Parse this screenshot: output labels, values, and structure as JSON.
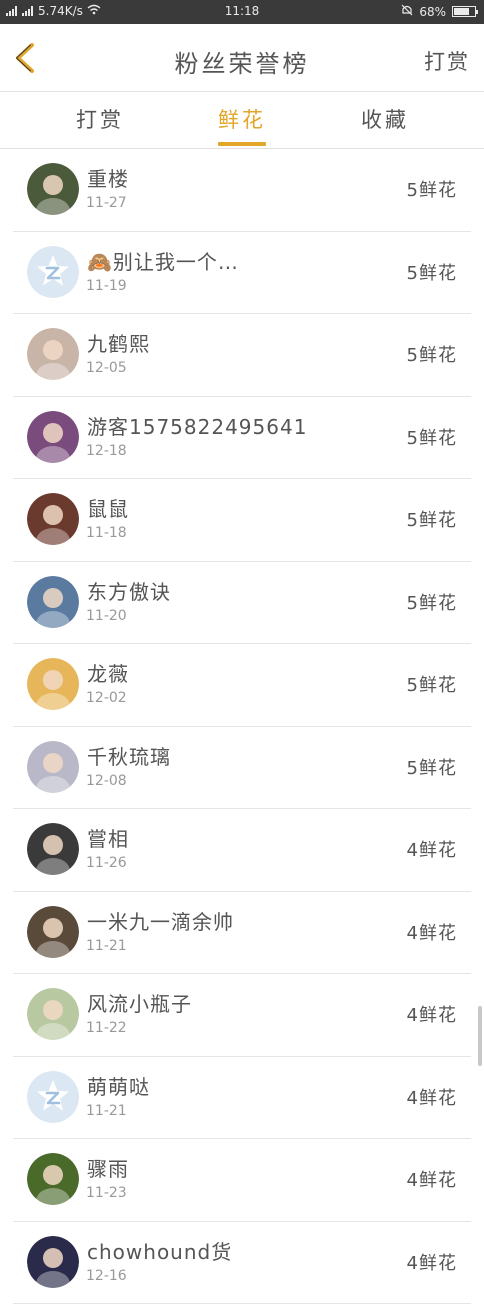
{
  "status_bar": {
    "network": "2G 4G",
    "speed": "5.74K/s",
    "time": "11:18",
    "battery": "68%"
  },
  "header": {
    "title": "粉丝荣誉榜",
    "right_action": "打赏",
    "back_icon": "chevron-left-icon",
    "accent_color": "#e3a52a"
  },
  "tabs": [
    {
      "label": "打赏",
      "active": false
    },
    {
      "label": "鲜花",
      "active": true
    },
    {
      "label": "收藏",
      "active": false
    }
  ],
  "fans": [
    {
      "name": "重楼",
      "date": "11-27",
      "count": "5鲜花",
      "avatar": "user-photo-girl",
      "avatar_color": "#4a5a3a"
    },
    {
      "name": "🙈别让我一个…",
      "date": "11-19",
      "count": "5鲜花",
      "avatar": "default-z-avatar",
      "avatar_color": "#dbe7f2"
    },
    {
      "name": "九鹤熙",
      "date": "12-05",
      "count": "5鲜花",
      "avatar": "user-photo-anime",
      "avatar_color": "#c9b4a8"
    },
    {
      "name": "游客15758224956​41",
      "date": "12-18",
      "count": "5鲜花",
      "avatar": "user-photo-anime-purple",
      "avatar_color": "#7a4b7d"
    },
    {
      "name": "鼠鼠",
      "date": "11-18",
      "count": "5鲜花",
      "avatar": "user-photo-woman",
      "avatar_color": "#6b3a2e"
    },
    {
      "name": "东方傲诀",
      "date": "11-20",
      "count": "5鲜花",
      "avatar": "user-photo-man",
      "avatar_color": "#5a7aa0"
    },
    {
      "name": "龙薇",
      "date": "12-02",
      "count": "5鲜花",
      "avatar": "user-photo-anime-orange",
      "avatar_color": "#e8b65a"
    },
    {
      "name": "千秋琉璃",
      "date": "12-08",
      "count": "5鲜花",
      "avatar": "user-photo-anime-white",
      "avatar_color": "#b8b8c8"
    },
    {
      "name": "嘗相",
      "date": "11-26",
      "count": "4鲜花",
      "avatar": "user-photo-girl-face",
      "avatar_color": "#3a3a3a"
    },
    {
      "name": "一米九一滴余帅",
      "date": "11-21",
      "count": "4鲜花",
      "avatar": "user-photo-boy",
      "avatar_color": "#5a4a3a"
    },
    {
      "name": "风流小瓶子",
      "date": "11-22",
      "count": "4鲜花",
      "avatar": "user-photo-hedgehog",
      "avatar_color": "#b8c8a0"
    },
    {
      "name": "萌萌哒",
      "date": "11-21",
      "count": "4鲜花",
      "avatar": "default-z-avatar",
      "avatar_color": "#dbe7f2"
    },
    {
      "name": "骤雨",
      "date": "11-23",
      "count": "4鲜花",
      "avatar": "user-photo-field",
      "avatar_color": "#4a6a2a"
    },
    {
      "name": "chowhound货",
      "date": "12-16",
      "count": "4鲜花",
      "avatar": "user-photo-dark",
      "avatar_color": "#2a2a4a"
    }
  ]
}
